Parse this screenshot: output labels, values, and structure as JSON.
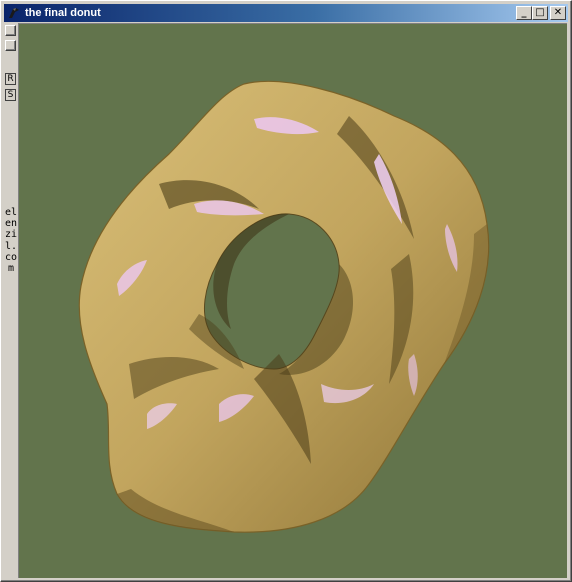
{
  "window": {
    "title": "the final donut",
    "icons": {
      "app": "app-icon",
      "minimize": "minimize-icon",
      "maximize": "maximize-icon",
      "close": "close-icon"
    },
    "minimize_glyph": "_",
    "maximize_glyph": "□",
    "close_glyph": "✕"
  },
  "sidebar": {
    "toggle_icons": [
      "checkbox-icon",
      "checkbox-icon"
    ],
    "button_r": "R",
    "button_s": "S",
    "vertical_text": "elenzil.com"
  },
  "scene": {
    "background_color": "#62744c",
    "object_color": "#c8ad66",
    "highlight_color": "#e8c8f0",
    "shadow_color": "#4a3e1c"
  }
}
